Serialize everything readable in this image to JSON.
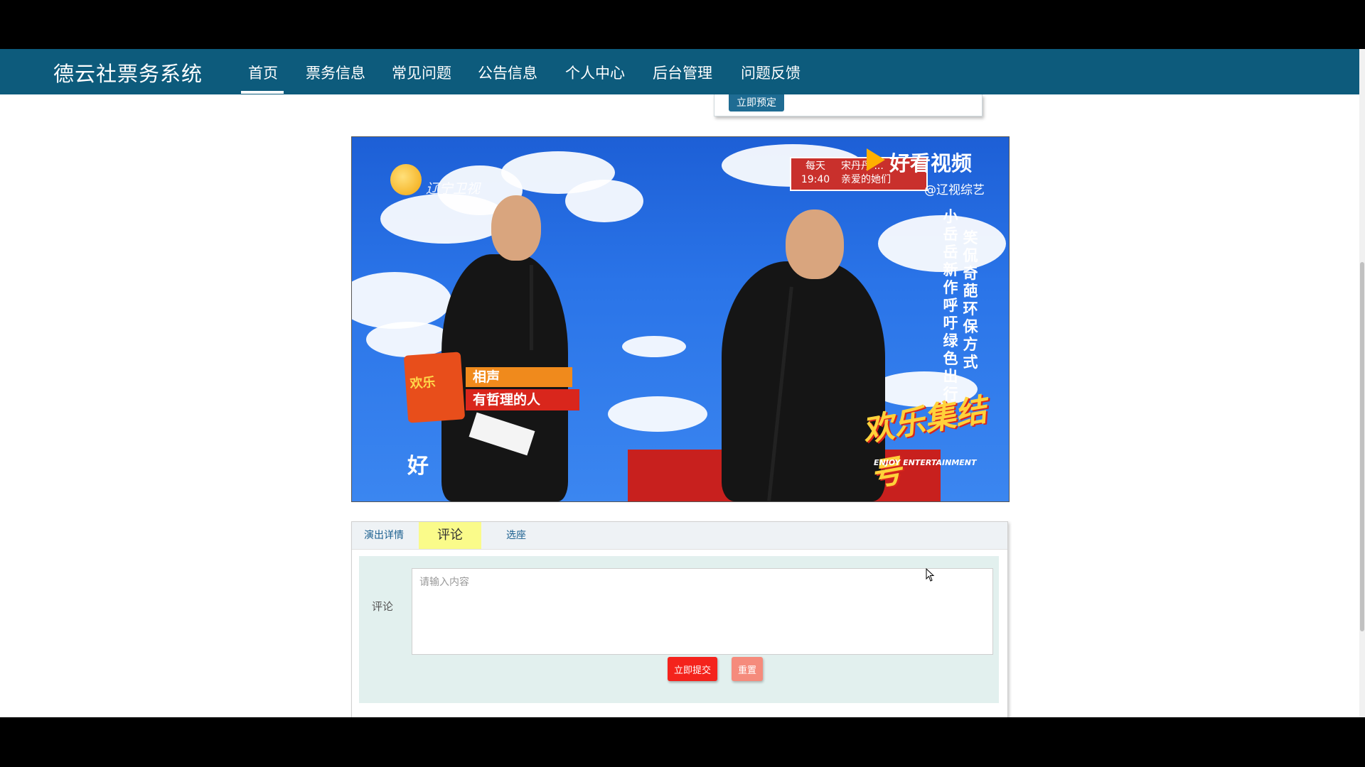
{
  "header": {
    "brand": "德云社票务系统",
    "nav": [
      {
        "label": "首页",
        "active": true
      },
      {
        "label": "票务信息"
      },
      {
        "label": "常见问题"
      },
      {
        "label": "公告信息"
      },
      {
        "label": "个人中心"
      },
      {
        "label": "后台管理"
      },
      {
        "label": "问题反馈"
      }
    ]
  },
  "dropdown": {
    "book_button": "立即预定"
  },
  "video": {
    "channel_logo": "辽宁卫视",
    "schedule_left": [
      "每天",
      "19:40"
    ],
    "schedule_right": [
      "宋丹丹 ...",
      "亲爱的她们"
    ],
    "platform": "好看视频",
    "handle": "@辽视综艺",
    "caption_col1": "小岳岳新作呼吁绿色出行",
    "caption_col2": "笑侃奇葩环保方式",
    "tag_logo": "欢乐",
    "tag_line1": "相声",
    "tag_line2": "有哲理的人",
    "subtitle": "好",
    "show_logo": "欢乐集结号",
    "show_logo_sub": "ENJOY ENTERTAINMENT"
  },
  "tabs": [
    {
      "label": "演出详情"
    },
    {
      "label": "评论",
      "active": true
    },
    {
      "label": "选座"
    }
  ],
  "comment_form": {
    "label": "评论",
    "placeholder": "请输入内容",
    "submit": "立即提交",
    "reset": "重置"
  },
  "colors": {
    "navbar": "#0d5b7c",
    "active_tab": "#fafb8a",
    "submit": "#f4231c",
    "reset": "#f58b7c",
    "form_bg": "#e2f0ee"
  }
}
